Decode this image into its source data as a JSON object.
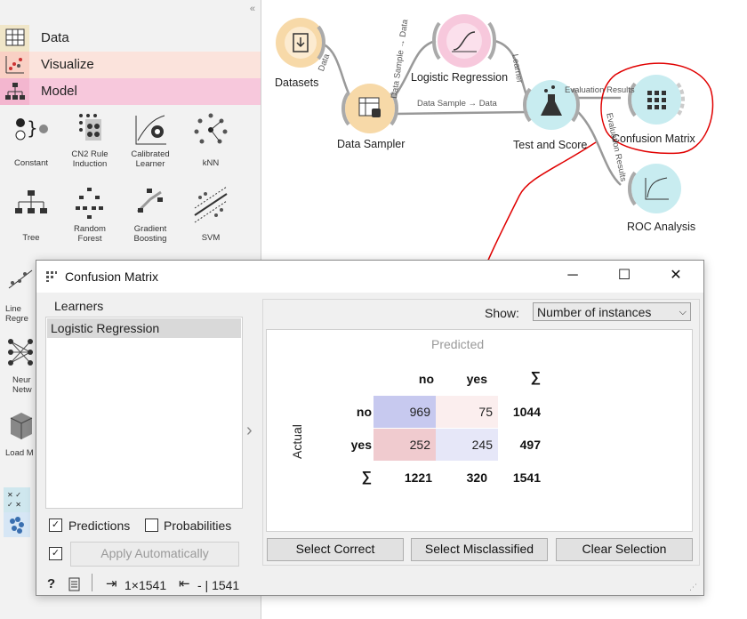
{
  "toolbox": {
    "collapse_glyph": "«",
    "categories": [
      {
        "label": "Data",
        "color": "#f0e6c8",
        "icon": "table-icon"
      },
      {
        "label": "Visualize",
        "color": "#f9d9d0",
        "icon": "scatter-icon"
      },
      {
        "label": "Model",
        "color": "#f7c8dc",
        "icon": "tree-icon"
      }
    ],
    "tools": [
      {
        "label": "Constant"
      },
      {
        "label": "CN2 Rule\nInduction"
      },
      {
        "label": "Calibrated\nLearner"
      },
      {
        "label": "kNN"
      },
      {
        "label": "Tree"
      },
      {
        "label": "Random\nForest"
      },
      {
        "label": "Gradient\nBoosting"
      },
      {
        "label": "SVM"
      },
      {
        "label": "Line\nRegre"
      },
      {
        "label": "Neur\nNetw"
      },
      {
        "label": "Load M"
      }
    ]
  },
  "canvas": {
    "nodes": {
      "datasets": "Datasets",
      "sampler": "Data Sampler",
      "logreg": "Logistic Regression",
      "testscore": "Test and Score",
      "confusion": "Confusion Matrix",
      "roc": "ROC Analysis"
    },
    "links": {
      "datasets_sampler": "Data",
      "sampler_logreg": "Data Sample → Data",
      "sampler_test": "Data Sample → Data",
      "logreg_test": "Learner",
      "test_confusion": "Evaluation Results",
      "test_roc": "Evaluation Results"
    },
    "colors": {
      "data_node": "#f7d9a8",
      "model_node": "#f7c8dc",
      "eval_node": "#c8ecf0",
      "annotation": "#e00000"
    }
  },
  "dialog": {
    "title": "Confusion Matrix",
    "learners_label": "Learners",
    "learners": [
      "Logistic Regression"
    ],
    "show_label": "Show:",
    "show_value": "Number of instances",
    "predicted_label": "Predicted",
    "actual_label": "Actual",
    "col_headers": [
      "no",
      "yes",
      "∑"
    ],
    "rows": [
      {
        "label": "no",
        "values": [
          "969",
          "75"
        ],
        "total": "1044"
      },
      {
        "label": "yes",
        "values": [
          "252",
          "245"
        ],
        "total": "497"
      }
    ],
    "sum_label": "∑",
    "col_totals": [
      "1221",
      "320",
      "1541"
    ],
    "buttons": {
      "select_correct": "Select Correct",
      "select_misclassified": "Select Misclassified",
      "clear_selection": "Clear Selection"
    },
    "predictions_label": "Predictions",
    "probabilities_label": "Probabilities",
    "apply_label": "Apply Automatically",
    "status_in": "1×1541",
    "status_out": "- | 1541",
    "arrow_glyph": "›"
  }
}
